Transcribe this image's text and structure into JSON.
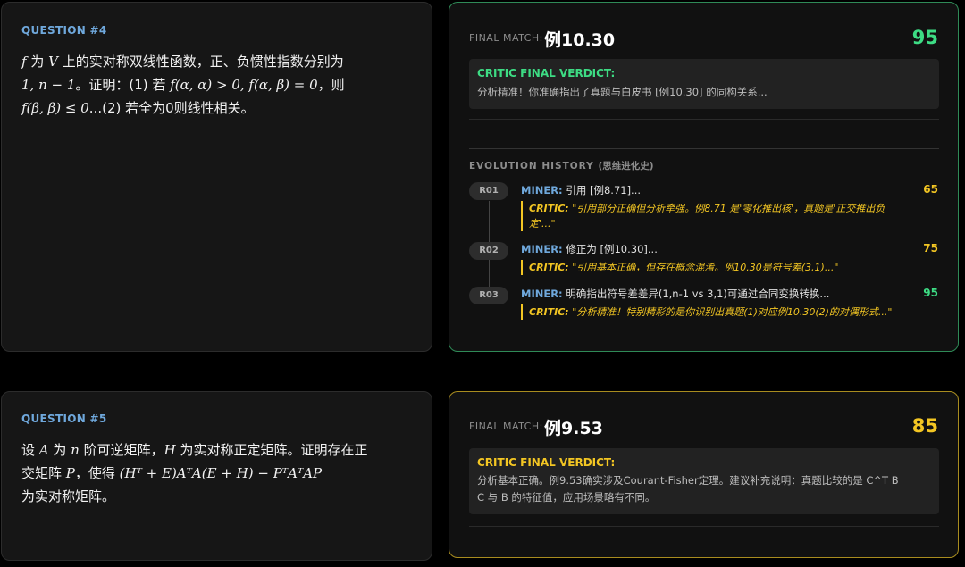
{
  "questions": [
    {
      "label": "QUESTION #4",
      "line1": {
        "m1": "f",
        "t1": " 为 ",
        "m2": "V",
        "t2": " 上的实对称双线性函数，正、负惯性指数分别为"
      },
      "line2": {
        "m1": "1, n − 1",
        "t1": "。证明：(1) 若 ",
        "m2": "f(α, α) > 0, f(α, β) = 0",
        "t2": "，则"
      },
      "line3": {
        "m1": "f(β, β) ≤ 0",
        "t1": "...(2) 若全为0则线性相关。"
      },
      "final_match_label": "FINAL MATCH:",
      "final_match_value": "例10.30",
      "score": "95",
      "verdict_title": "CRITIC FINAL VERDICT:",
      "verdict_lines": [
        "分析精准！你准确指出了真题与白皮书 [例10.30] 的同构关系..."
      ],
      "evolution": {
        "title": "EVOLUTION HISTORY",
        "subtitle": "(思维进化史)",
        "rounds": [
          {
            "id": "R01",
            "miner_who": "MINER:",
            "miner": " 引用 [例8.71]...",
            "critic_who": "CRITIC:",
            "critic_lines": [
              " \"引用部分正确但分析牵强。例8.71 是'零化推出核'，真题是'正交推出负",
              "定'...\""
            ],
            "score": "65",
            "color": "yellow"
          },
          {
            "id": "R02",
            "miner_who": "MINER:",
            "miner": " 修正为 [例10.30]...",
            "critic_who": "CRITIC:",
            "critic_lines": [
              " \"引用基本正确，但存在概念混淆。例10.30是符号差(3,1)...\""
            ],
            "score": "75",
            "color": "yellow"
          },
          {
            "id": "R03",
            "miner_who": "MINER:",
            "miner": " 明确指出符号差差异(1,n-1 vs 3,1)可通过合同变换转换...",
            "critic_who": "CRITIC:",
            "critic_lines": [
              " \"分析精准！特别精彩的是你识别出真题(1)对应例10.30(2)的对偶形式...\""
            ],
            "score": "95",
            "color": "green"
          }
        ]
      }
    },
    {
      "label": "QUESTION #5",
      "line1": {
        "t0": "设 ",
        "m1": "A",
        "t1": " 为 ",
        "m2": "n",
        "t2": " 阶可逆矩阵，",
        "m3": "H",
        "t3": " 为实对称正定矩阵。证明存在正"
      },
      "line2": {
        "t0": "交矩阵 ",
        "m1": "P",
        "t1": "，使得 ",
        "m2": "(Hᵀ + E)AᵀA(E + H) − PᵀAᵀAP"
      },
      "line3": {
        "t0": "为实对称矩阵。"
      },
      "final_match_label": "FINAL MATCH:",
      "final_match_value": "例9.53",
      "score": "85",
      "verdict_title": "CRITIC FINAL VERDICT:",
      "verdict_lines": [
        "分析基本正确。例9.53确实涉及Courant-Fisher定理。建议补充说明：真题比较的是 C^T B",
        "C 与 B 的特征值，应用场景略有不同。"
      ]
    }
  ],
  "colors": {
    "green": "#3ddc84",
    "yellow": "#f3c623",
    "blue": "#6fa8dc"
  }
}
